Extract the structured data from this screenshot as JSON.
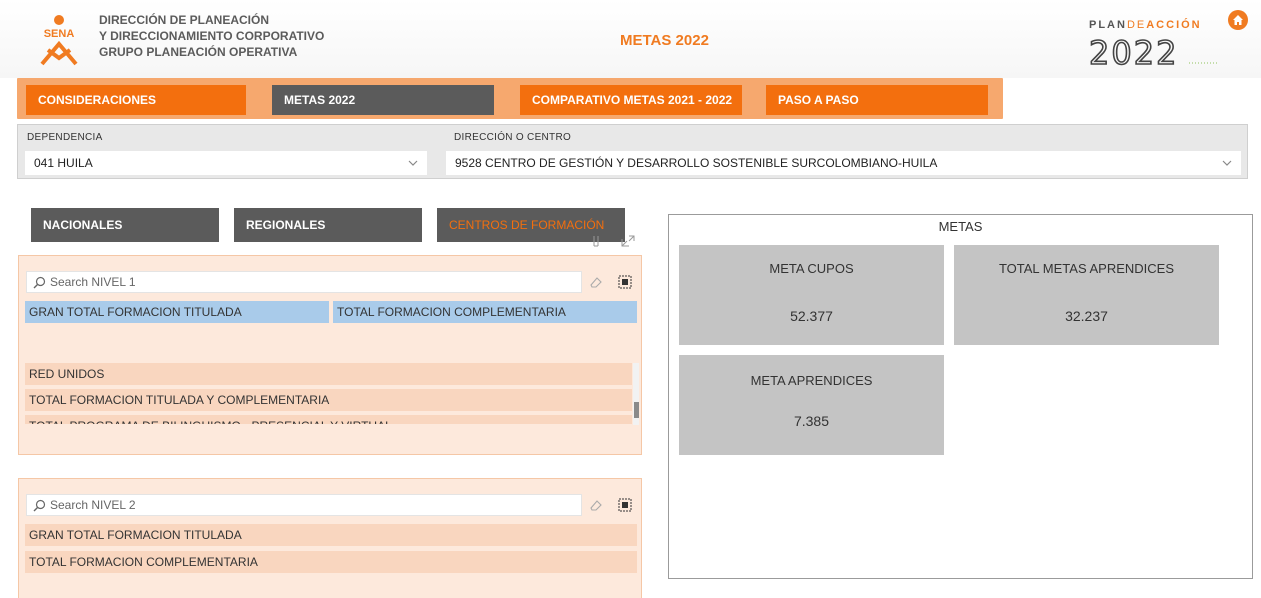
{
  "header": {
    "logo_text": "SENA",
    "org_line1": "DIRECCIÓN DE PLANEACIÓN",
    "org_line2": "Y DIRECCIONAMIENTO CORPORATIVO",
    "org_line3": "GRUPO PLANEACIÓN OPERATIVA",
    "title": "METAS 2022",
    "plan_word_1": "PLAN",
    "plan_word_2": "DE",
    "plan_word_3": "ACCIÓN",
    "plan_year": "2022"
  },
  "nav": {
    "items": [
      {
        "label": "CONSIDERACIONES",
        "style": "orange"
      },
      {
        "label": "METAS 2022",
        "style": "dark"
      },
      {
        "label": "COMPARATIVO METAS 2021 - 2022",
        "style": "orange"
      },
      {
        "label": "PASO A PASO",
        "style": "orange"
      }
    ]
  },
  "filters": {
    "dependencia_label": "DEPENDENCIA",
    "dependencia_value": "041 HUILA",
    "direccion_label": "DIRECCIÓN O CENTRO",
    "direccion_value": "9528 CENTRO DE GESTIÓN Y DESARROLLO SOSTENIBLE SURCOLOMBIANO-HUILA"
  },
  "subnav": {
    "items": [
      {
        "label": "NACIONALES"
      },
      {
        "label": "REGIONALES"
      },
      {
        "label": "CENTROS DE FORMACIÓN"
      }
    ]
  },
  "slicer1": {
    "search_placeholder": "Search NIVEL 1",
    "selected_left": "GRAN TOTAL FORMACION TITULADA",
    "selected_right": "TOTAL FORMACION COMPLEMENTARIA",
    "rows": [
      "RED UNIDOS",
      "TOTAL FORMACION TITULADA Y COMPLEMENTARIA",
      "TOTAL PROGRAMA DE BILINGUISMO - PRESENCIAL Y VIRTUAL"
    ]
  },
  "slicer2": {
    "search_placeholder": "Search NIVEL 2",
    "rows": [
      "GRAN TOTAL FORMACION TITULADA",
      "TOTAL FORMACION COMPLEMENTARIA"
    ]
  },
  "metas": {
    "title": "METAS",
    "cards": [
      {
        "label": "META CUPOS",
        "value": "52.377"
      },
      {
        "label": "TOTAL METAS APRENDICES",
        "value": "32.237"
      },
      {
        "label": "META APRENDICES",
        "value": "7.385"
      }
    ]
  },
  "colors": {
    "accent_orange": "#f36f0e",
    "dark_gray": "#5b5b5b",
    "card_gray": "#c4c4c4",
    "selected_blue": "#a9cbea"
  }
}
